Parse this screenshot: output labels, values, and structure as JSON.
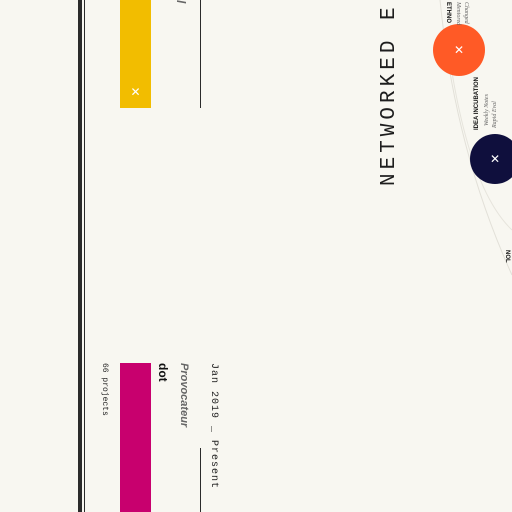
{
  "timeline": {
    "top_entry": {
      "role_fragment": "l",
      "close_symbol": "✕"
    },
    "bottom_entry": {
      "date_range": "Jan 2019 _ Present",
      "role": "Provocateur",
      "name": "dot",
      "projects": "66 projects",
      "close_symbol": "✕"
    }
  },
  "network": {
    "heading": "NETWORKED E",
    "nodes": [
      {
        "label": "ETHNO",
        "details": [
          "Mentored",
          "Changed"
        ],
        "color": "#ff5a26",
        "close_symbol": "✕"
      },
      {
        "label": "IDEA INCUBATION",
        "details": [
          "Weekly Notes",
          "Rapid Eval"
        ],
        "color": "#0f0f3d",
        "close_symbol": "✕"
      }
    ],
    "partial_label": "NOL"
  },
  "colors": {
    "background": "#f8f7f1",
    "bar_yellow": "#f2bd00",
    "bar_magenta": "#c8006e",
    "rail": "#2b2b2b"
  }
}
